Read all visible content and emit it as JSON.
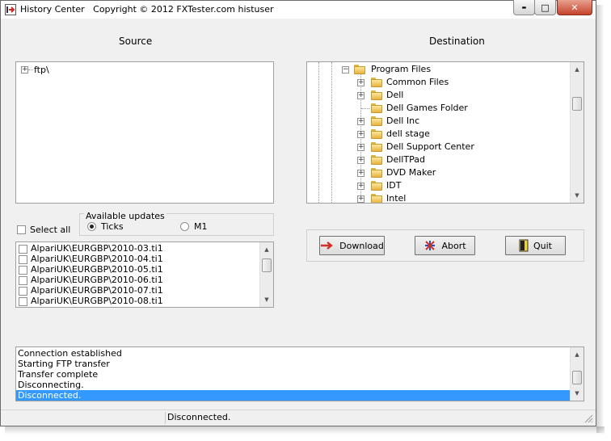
{
  "window": {
    "title": "History Center   Copyright © 2012 FXTester.com histuser",
    "controls": {
      "minimize": "▬",
      "maximize": "□",
      "close": "✕"
    }
  },
  "source": {
    "label": "Source",
    "tree": [
      {
        "label": "ftp\\",
        "expander": "+"
      }
    ]
  },
  "destination": {
    "label": "Destination",
    "parent": {
      "label": "Program Files",
      "expander": "−"
    },
    "tree": [
      {
        "label": "Common Files",
        "expander": "+"
      },
      {
        "label": "Dell",
        "expander": "+"
      },
      {
        "label": "Dell Games Folder",
        "expander": ""
      },
      {
        "label": "Dell Inc",
        "expander": "+"
      },
      {
        "label": "dell stage",
        "expander": "+"
      },
      {
        "label": "Dell Support Center",
        "expander": "+"
      },
      {
        "label": "DellTPad",
        "expander": "+"
      },
      {
        "label": "DVD Maker",
        "expander": "+"
      },
      {
        "label": "IDT",
        "expander": "+"
      },
      {
        "label": "Intel",
        "expander": "+"
      }
    ]
  },
  "select_all": {
    "label": "Select all",
    "checked": false
  },
  "updates": {
    "legend": "Available updates",
    "options": [
      {
        "label": "Ticks",
        "selected": true
      },
      {
        "label": "M1",
        "selected": false
      }
    ]
  },
  "files": [
    "AlpariUK\\EURGBP\\2010-03.ti1",
    "AlpariUK\\EURGBP\\2010-04.ti1",
    "AlpariUK\\EURGBP\\2010-05.ti1",
    "AlpariUK\\EURGBP\\2010-06.ti1",
    "AlpariUK\\EURGBP\\2010-07.ti1",
    "AlpariUK\\EURGBP\\2010-08.ti1"
  ],
  "buttons": {
    "download": "Download",
    "abort": "Abort",
    "quit": "Quit"
  },
  "log": [
    "Connection established",
    "Starting FTP transfer",
    "Transfer complete",
    "Disconnecting.",
    "Disconnected."
  ],
  "status": {
    "text": "Disconnected."
  },
  "colors": {
    "selection": "#3399ff",
    "accent_red": "#d0302a",
    "folder": "#f3c853"
  }
}
